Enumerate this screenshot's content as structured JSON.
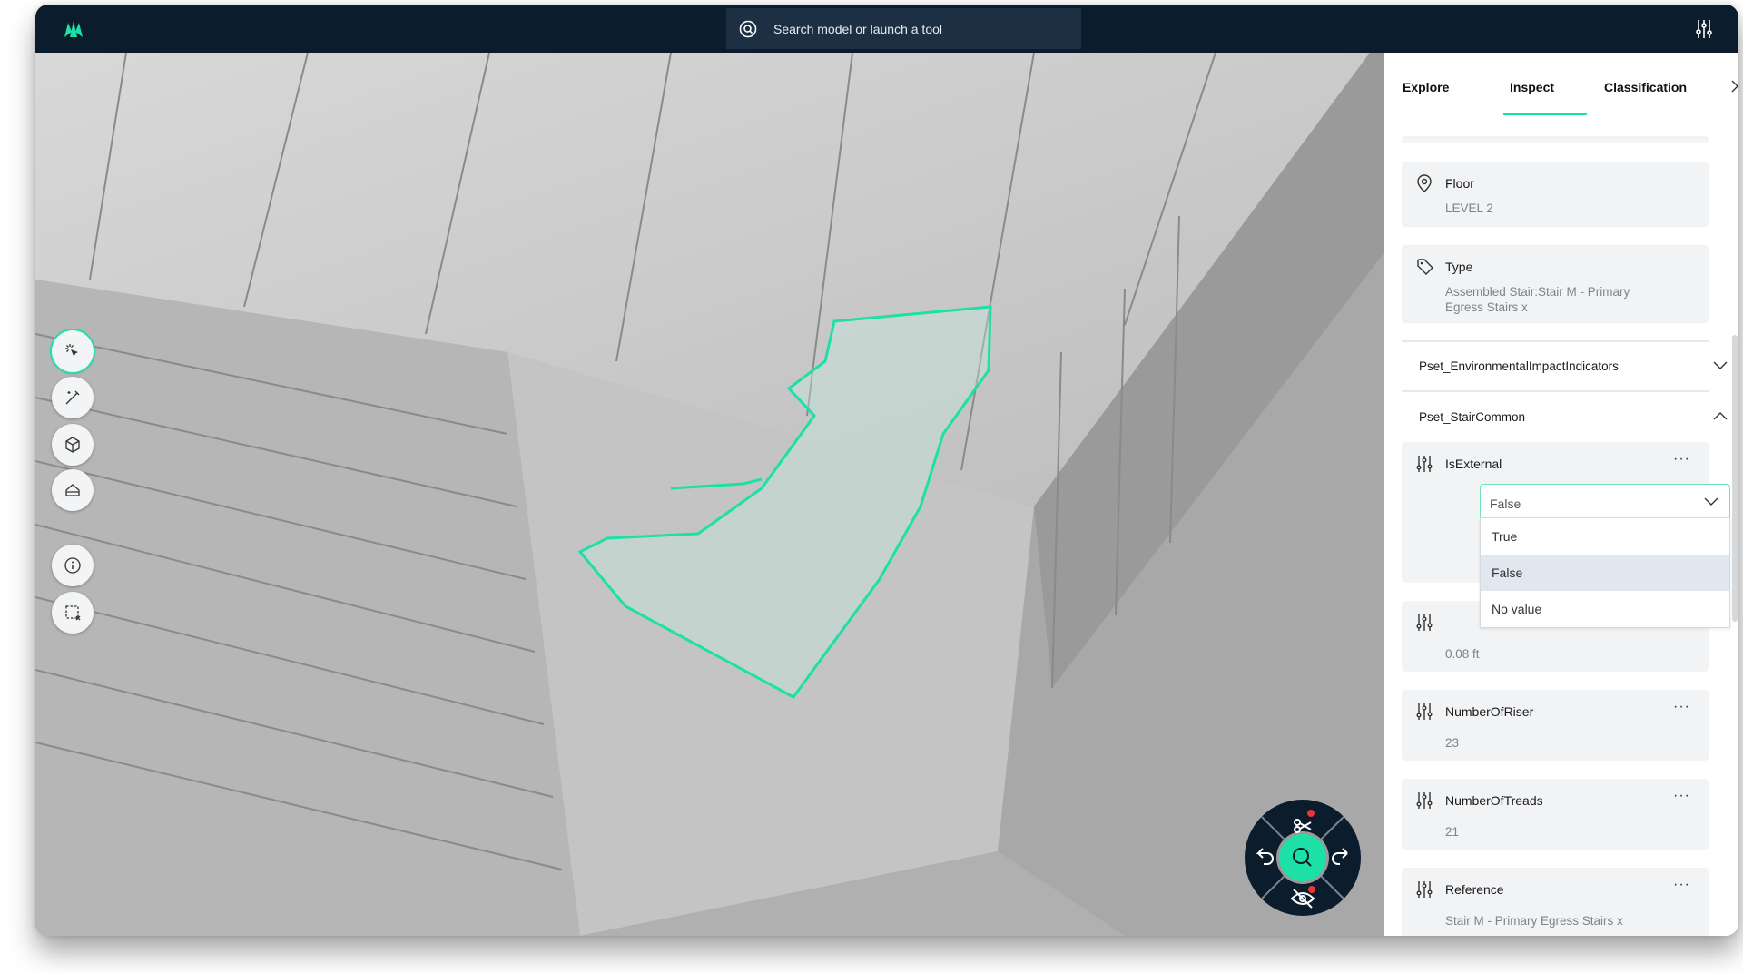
{
  "topbar": {
    "search_placeholder": "Search model or launch a tool",
    "logo": "logo-icon",
    "settings_icon": "sliders-icon"
  },
  "colors": {
    "accent": "#1de0a6",
    "topbar": "#0b1c2c",
    "selection_outline": "#1de0a6"
  },
  "toolbar": {
    "tools": [
      "select-icon",
      "measure-icon",
      "model-icon",
      "section-icon",
      "info-icon",
      "box-select-icon"
    ],
    "active": "select-icon"
  },
  "nav_wheel": {
    "center": "search-icon",
    "top": "scissors-icon",
    "left": "undo-icon",
    "right": "redo-icon",
    "bottom": "hide-icon"
  },
  "panel": {
    "tabs": [
      {
        "label": "Explore"
      },
      {
        "label": "Inspect",
        "active": true
      },
      {
        "label": "Classification"
      }
    ],
    "floor": {
      "label": "Floor",
      "value": "LEVEL 2"
    },
    "type": {
      "label": "Type",
      "value": "Assembled Stair:Stair M - Primary Egress Stairs x"
    },
    "psets": [
      {
        "label": "Pset_EnvironmentalImpactIndicators",
        "expanded": false
      },
      {
        "label": "Pset_StairCommon",
        "expanded": true
      }
    ],
    "is_external": {
      "label": "IsExternal",
      "selected": "False",
      "options": [
        "True",
        "False",
        "No value"
      ],
      "highlighted": "False"
    },
    "hidden_prop": {
      "value": "0.08 ft"
    },
    "riser": {
      "label": "NumberOfRiser",
      "value": "23"
    },
    "treads": {
      "label": "NumberOfTreads",
      "value": "21"
    },
    "reference": {
      "label": "Reference",
      "value": "Stair M - Primary Egress Stairs x"
    },
    "more_label": "···"
  }
}
